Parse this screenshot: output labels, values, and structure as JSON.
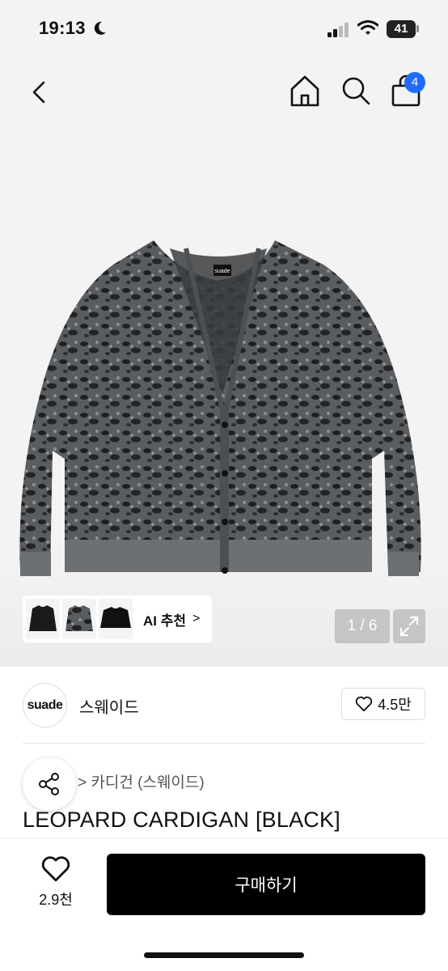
{
  "status": {
    "time": "19:13",
    "battery": "41"
  },
  "nav": {
    "cart_count": "4"
  },
  "gallery": {
    "counter": "1 / 6",
    "ai_label": "AI 추천",
    "ai_chevron": ">"
  },
  "product_image": {
    "logo_text": "suade"
  },
  "brand": {
    "logo_text": "suade",
    "name": "스웨이드",
    "likes": "4.5만"
  },
  "breadcrumb": "> 카디건 (스웨이드)",
  "product": {
    "title": "LEOPARD CARDIGAN [BLACK]"
  },
  "bottom": {
    "wish_count": "2.9천",
    "buy_label": "구매하기"
  },
  "icons": [
    "moon-icon",
    "signal-icon",
    "wifi-icon",
    "back-icon",
    "home-icon",
    "search-icon",
    "cart-icon",
    "expand-icon",
    "heart-icon",
    "share-icon",
    "chevron-right-icon"
  ],
  "colors": {
    "badge": "#1f6bff",
    "buy_button": "#000000"
  }
}
